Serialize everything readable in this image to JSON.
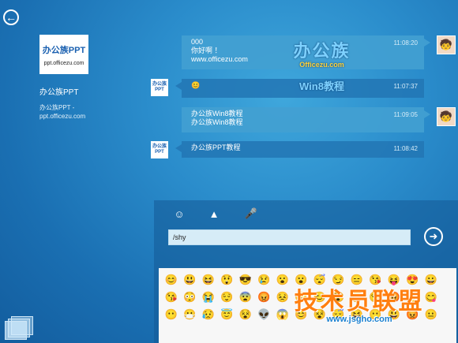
{
  "contact": {
    "logo_text": "办公族PPT",
    "logo_url": "ppt.officezu.com",
    "name": "办公族PPT",
    "subtitle": "办公族PPT - ppt.officezu.com"
  },
  "messages": [
    {
      "direction": "out",
      "lines": [
        "000",
        "你好啊 ！",
        "www.officezu.com"
      ],
      "time": "11:08:20"
    },
    {
      "direction": "in",
      "lines": [
        "😊"
      ],
      "time": "11:07:37"
    },
    {
      "direction": "out",
      "lines": [
        "办公族Win8教程",
        "办公族Win8教程"
      ],
      "time": "11:09:05"
    },
    {
      "direction": "in",
      "lines": [
        "办公族PPT教程"
      ],
      "time": "11:08:42"
    }
  ],
  "watermark": {
    "brand": "办公族",
    "site": "Officezu.com",
    "tag": "Win8教程"
  },
  "compose": {
    "input_value": "/shy",
    "tools": [
      "smiley-icon",
      "image-icon",
      "microphone-icon"
    ]
  },
  "emoji": [
    "😊",
    "😃",
    "😆",
    "😲",
    "😎",
    "😢",
    "😮",
    "😮",
    "😴",
    "😏",
    "😑",
    "😘",
    "😝",
    "😍",
    "😀",
    "😘",
    "😳",
    "😭",
    "😌",
    "😨",
    "😡",
    "😣",
    "😗",
    "😊",
    "😵",
    "😁",
    "😏",
    "😡",
    "😤",
    "😋",
    "😶",
    "😷",
    "😥",
    "😇",
    "😵",
    "👽",
    "😱",
    "😊",
    "😵",
    "😴",
    "😆",
    "😶",
    "😃",
    "😡",
    "😐"
  ],
  "watermark2": {
    "title": "技术员联盟",
    "site": "www.jsgho.com"
  }
}
